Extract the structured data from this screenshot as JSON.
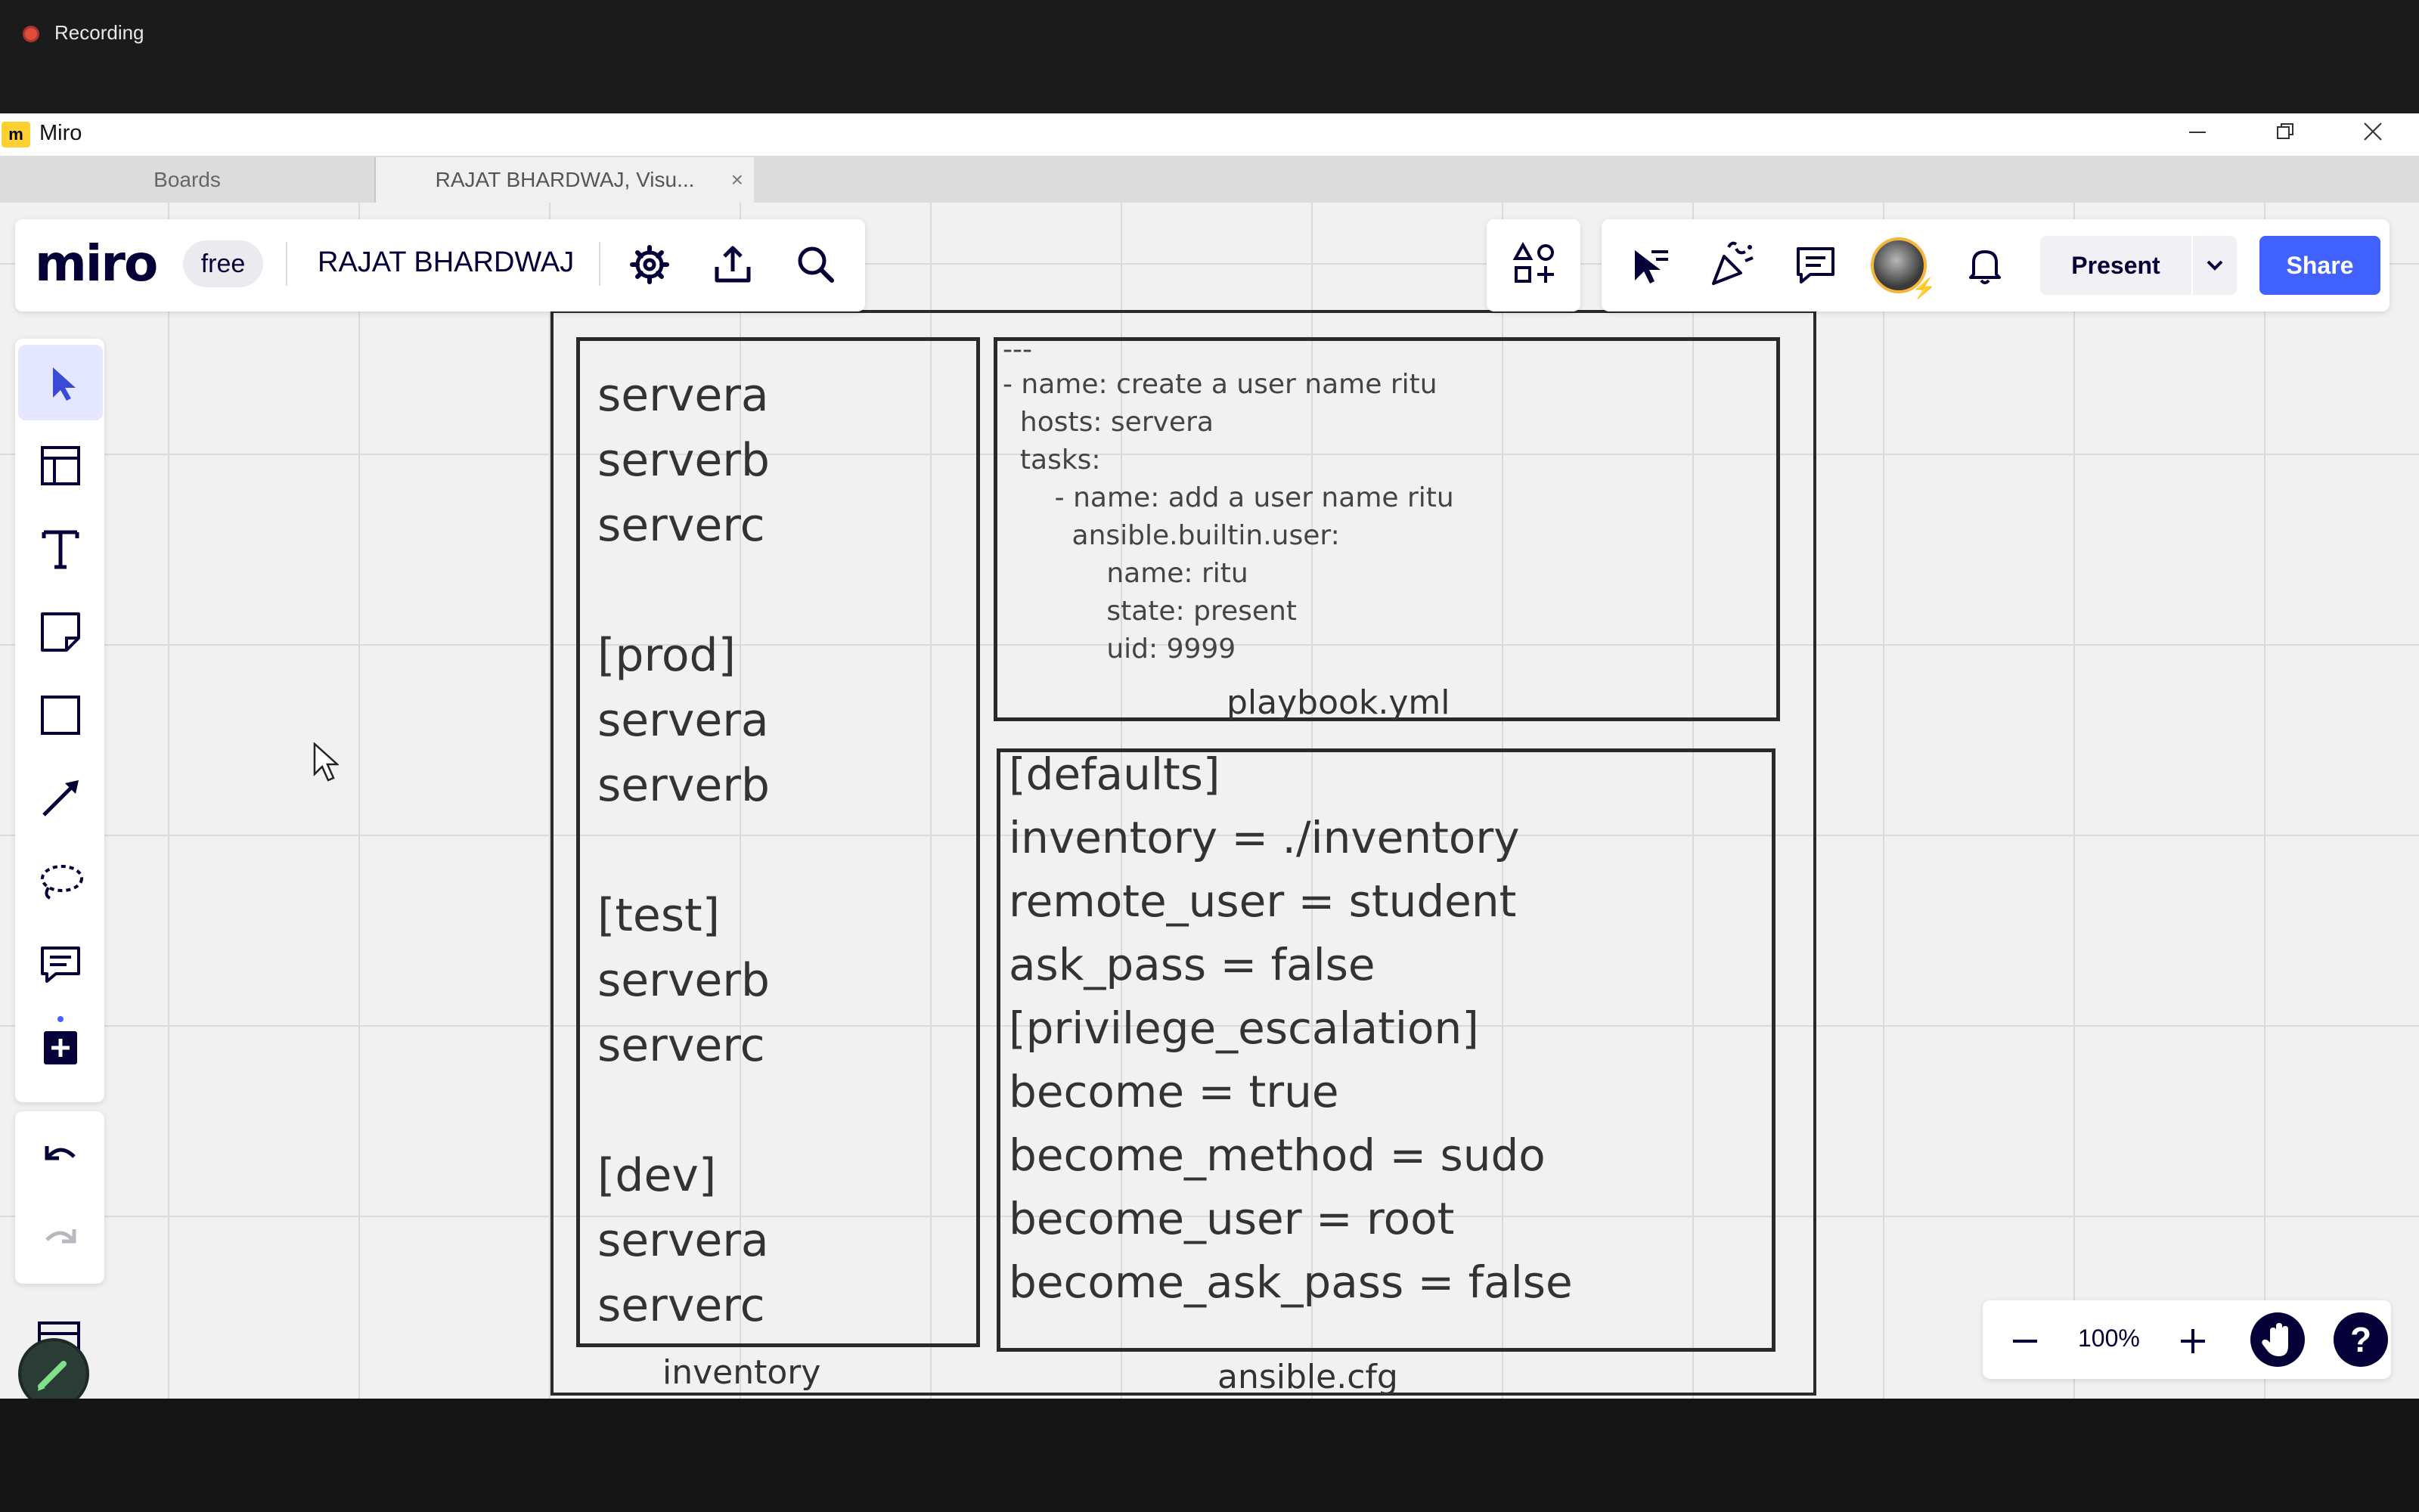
{
  "recording": {
    "label": "Recording"
  },
  "window": {
    "title": "Miro",
    "controls": [
      "minimize",
      "restore",
      "close"
    ]
  },
  "tabs": [
    {
      "label": "Boards"
    },
    {
      "label": "RAJAT BHARDWAJ, Visu..."
    }
  ],
  "topbar": {
    "logo": "miro",
    "plan_badge": "free",
    "board_name": "RAJAT BHARDWAJ",
    "present_label": "Present",
    "share_label": "Share"
  },
  "board": {
    "inventory_lines": [
      "servera",
      "serverb",
      "serverc",
      "[prod]",
      "servera",
      "serverb",
      "[test]",
      "serverb",
      "serverc",
      "[dev]",
      "servera",
      "serverc"
    ],
    "inventory_caption": "inventory",
    "playbook_lines": [
      "---",
      "- name: create a user name ritu",
      "  hosts: servera",
      "  tasks:",
      "      - name: add a user name ritu",
      "        ansible.builtin.user:",
      "            name: ritu",
      "            state: present",
      "            uid: 9999"
    ],
    "playbook_caption": "playbook.yml",
    "cfg_lines": [
      "[defaults]",
      "inventory = ./inventory",
      "remote_user = student",
      "ask_pass = false",
      "[privilege_escalation]",
      "become = true",
      "become_method = sudo",
      "become_user = root",
      "become_ask_pass = false"
    ],
    "cfg_caption": "ansible.cfg"
  },
  "zoom": {
    "level": "100%"
  },
  "help": {
    "label": "?"
  },
  "colors": {
    "accent": "#4262ff",
    "brand_dark": "#050038",
    "miro_yellow": "#ffd02f",
    "recording_red": "#e04b3c"
  }
}
